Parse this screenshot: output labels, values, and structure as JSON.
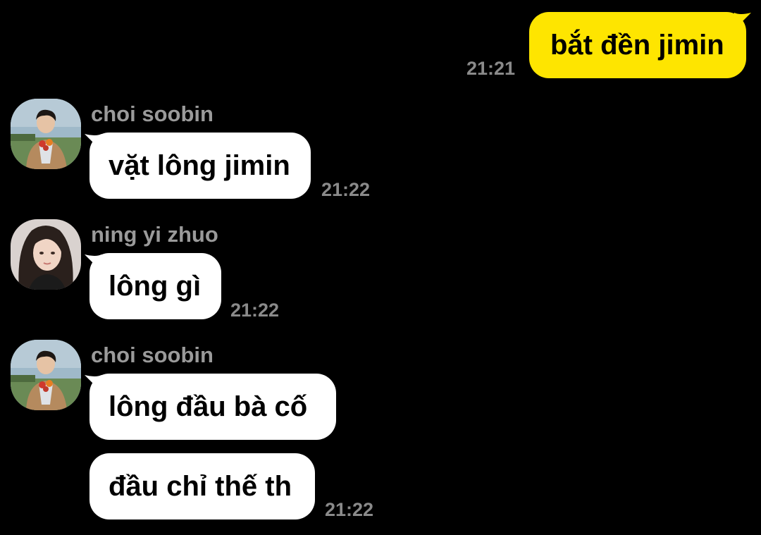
{
  "colors": {
    "background": "#000000",
    "outgoing_bubble": "#FEE500",
    "incoming_bubble": "#FFFFFF",
    "timestamp": "#8a8a8a",
    "sender_name": "#9a9a9a"
  },
  "messages": {
    "m1": {
      "text": "bắt đền jimin",
      "time": "21:21"
    },
    "m2": {
      "sender": "choi soobin",
      "text": "vặt lông jimin",
      "time": "21:22",
      "avatar_icon": "soobin-avatar-icon"
    },
    "m3": {
      "sender": "ning yi zhuo",
      "text": "lông gì",
      "time": "21:22",
      "avatar_icon": "ningning-avatar-icon"
    },
    "m4": {
      "sender": "choi soobin",
      "text1": "lông đầu bà cố",
      "text2": "đầu chỉ thế th",
      "time": "21:22",
      "avatar_icon": "soobin-avatar-icon"
    }
  }
}
